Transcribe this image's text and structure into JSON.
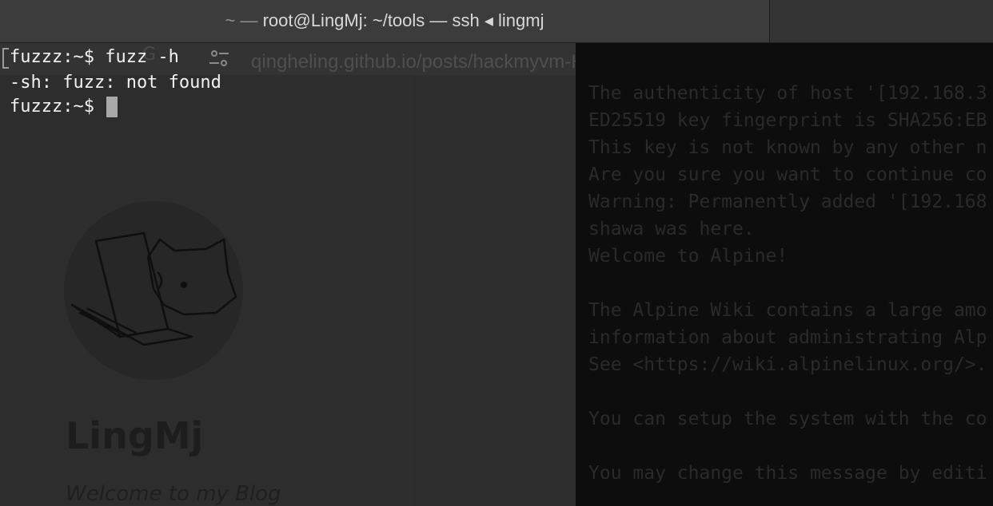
{
  "window": {
    "title_prefix": "~ — ",
    "title": "root@LingMj: ~/tools — ssh ◂ lingmj"
  },
  "browser": {
    "url": "qingheling.github.io/posts/hackmyvm-Hero复盘/",
    "blog_name": "LingMj",
    "blog_tagline": "Welcome to my Blog"
  },
  "remote_terminal": {
    "lines": [
      "The authenticity of host '[192.168.3",
      "ED25519 key fingerprint is SHA256:EB",
      "This key is not known by any other n",
      "Are you sure you want to continue co",
      "Warning: Permanently added '[192.168",
      "shawa was here.",
      "Welcome to Alpine!",
      "",
      "The Alpine Wiki contains a large amo",
      "information about administrating Alp",
      "See <https://wiki.alpinelinux.org/>.",
      "",
      "You can setup the system with the co",
      "",
      "You may change this message by editi"
    ]
  },
  "terminal": {
    "line1": "fuzzz:~$ fuzz -h",
    "line2": "-sh: fuzz: not found",
    "prompt": "fuzzz:~$ "
  }
}
